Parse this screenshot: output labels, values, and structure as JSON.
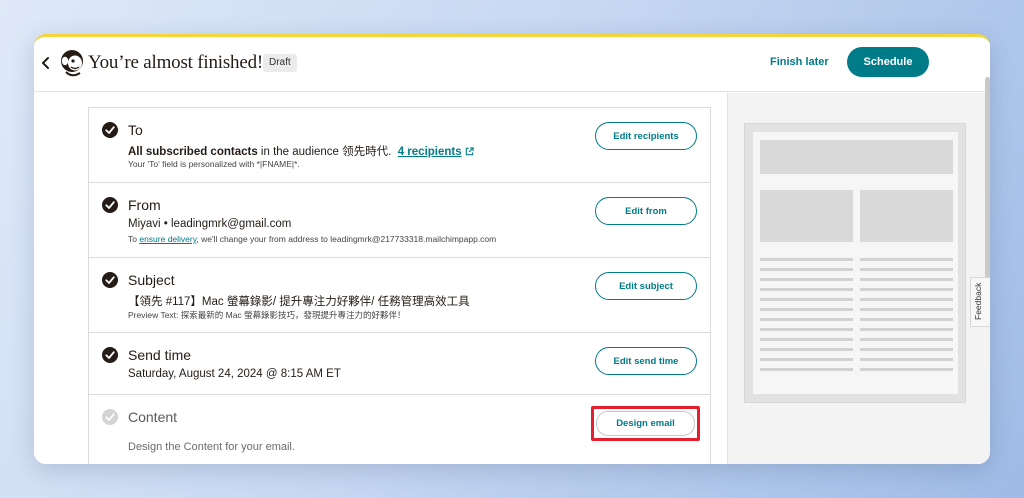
{
  "header": {
    "title": "You’re almost finished!",
    "status_badge": "Draft",
    "finish_later_label": "Finish later",
    "schedule_label": "Schedule"
  },
  "checklist": {
    "to": {
      "title": "To",
      "value_bold": "All subscribed contacts",
      "value_mid": " in the audience 领先時代.",
      "recipients_link": "4 recipients",
      "note": "Your 'To' field is personalized with *|FNAME|*.",
      "button": "Edit recipients",
      "status": "complete"
    },
    "from": {
      "title": "From",
      "value": "Miyavi  •  leadingmrk@gmail.com",
      "note_prefix": "To ",
      "note_link": "ensure delivery",
      "note_suffix": ", we'll change your from address to leadingmrk@217733318.mailchimpapp.com",
      "button": "Edit from",
      "status": "complete"
    },
    "subject": {
      "title": "Subject",
      "value": "【領先 #117】Mac 螢幕錄影/ 提升專注力好夥伴/ 任務管理高效工具",
      "note": "Preview Text: 探索最新的 Mac 螢幕錄影技巧，發現提升專注力的好夥伴！",
      "button": "Edit subject",
      "status": "complete"
    },
    "send_time": {
      "title": "Send time",
      "value": "Saturday, August 24, 2024 @ 8:15 AM ET",
      "button": "Edit send time",
      "status": "complete"
    },
    "content": {
      "title": "Content",
      "note": "Design the Content for your email.",
      "button": "Design email",
      "status": "incomplete"
    }
  },
  "sidebar": {
    "feedback_label": "Feedback"
  },
  "colors": {
    "accent": "#007c89",
    "highlight": "#e4202e",
    "check": "#241c15",
    "brand_stripe": "#f2d63b"
  },
  "icons": {
    "back": "chevron-left-icon",
    "logo": "mailchimp-logo-icon",
    "check": "check-circle-icon",
    "external": "external-link-icon"
  }
}
